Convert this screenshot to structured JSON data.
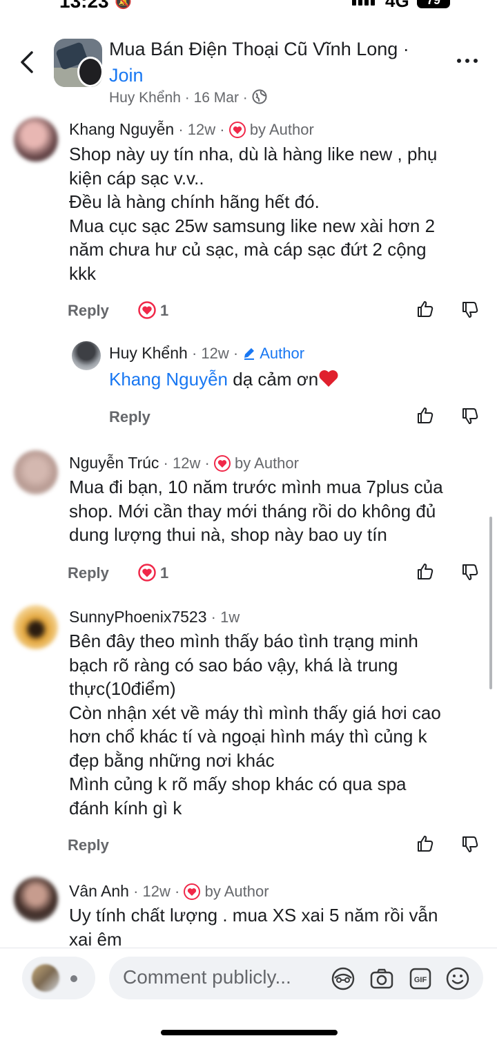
{
  "status_bar": {
    "time": "13:23",
    "network": "4G",
    "battery": "79"
  },
  "header": {
    "group_name": "Mua Bán Điện Thoại Cũ Vĩnh Long ·",
    "join_label": "Join",
    "author": "Huy Khểnh",
    "date": "16 Mar",
    "separator": "·"
  },
  "comments": [
    {
      "name": "Khang Nguyễn",
      "age": "12w",
      "liked_by": "by Author",
      "lines": [
        "Shop này uy tín nha, dù là hàng like new , phụ",
        "kiện cáp sạc v.v..",
        "Đều là hàng chính hãng hết đó.",
        "Mua cục sạc 25w samsung like new xài hơn 2",
        "năm chưa hư củ sạc, mà cáp sạc đứt 2 cộng",
        "kkk"
      ],
      "reply_label": "Reply",
      "reactions": "1"
    },
    {
      "name": "Huy Khểnh",
      "age": "12w",
      "author_badge": "Author",
      "mention": "Khang Nguyễn",
      "text": " dạ cảm ơn",
      "reply_label": "Reply"
    },
    {
      "name": "Nguyễn Trúc",
      "age": "12w",
      "liked_by": "by Author",
      "lines": [
        "Mua đi bạn, 10 năm trước mình mua 7plus của",
        "shop. Mới cần thay mới tháng rồi do không đủ",
        "dung lượng thui nà, shop này bao uy tín"
      ],
      "reply_label": "Reply",
      "reactions": "1"
    },
    {
      "name": "SunnyPhoenix7523",
      "age": "1w",
      "lines": [
        "Bên đây theo mình thấy báo tình trạng minh",
        "bạch rõ ràng có sao báo vậy, khá là trung",
        "thực(10điểm)",
        "Còn nhận xét về máy thì mình thấy giá hơi cao",
        "hơn chổ khác tí và ngoại hình máy thì củng k",
        "đẹp bằng những nơi khác",
        "Mình củng k rõ mấy shop khác có qua spa",
        "đánh kính gì k"
      ],
      "reply_label": "Reply"
    },
    {
      "name": "Vân Anh",
      "age": "12w",
      "liked_by": "by Author",
      "lines": [
        "Uy tính chất lượng . mua XS xai 5 năm rồi vẫn",
        "xai êm"
      ]
    }
  ],
  "composer": {
    "placeholder": "Comment publicly..."
  },
  "colors": {
    "link": "#1877f2",
    "secondary_text": "#65676b",
    "reaction_red": "#f02849"
  }
}
